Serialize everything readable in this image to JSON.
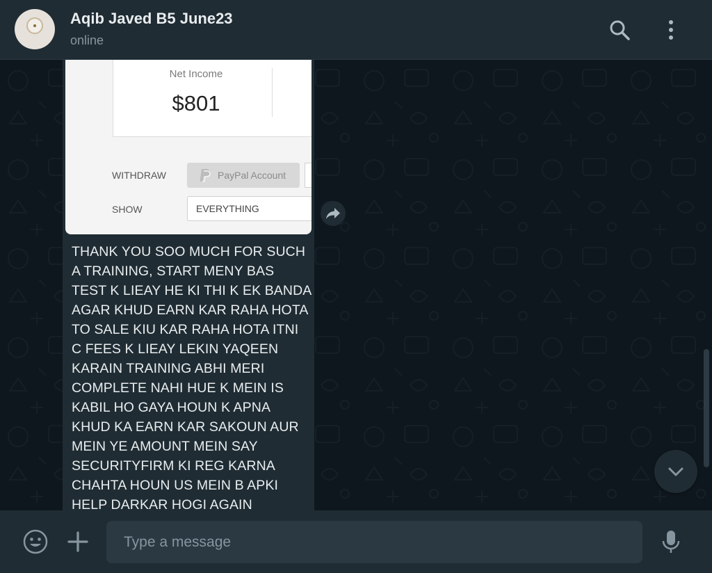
{
  "header": {
    "contact_name": "Aqib Javed B5 June23",
    "status": "online",
    "icons": [
      "search-icon",
      "menu-icon"
    ]
  },
  "message": {
    "screenshot": {
      "net_income_label": "Net Income",
      "net_income_value": "$801",
      "withdraw_label": "WITHDRAW",
      "paypal_button": "PayPal Account",
      "show_label": "SHOW",
      "show_value": "EVERYTHING"
    },
    "text": "THANK YOU SOO MUCH FOR SUCH A TRAINING, START MENY BAS TEST K LIEAY HE KI THI K EK BANDA AGAR KHUD EARN KAR RAHA HOTA TO SALE KIU KAR RAHA HOTA ITNI C FEES K LIEAY LEKIN YAQEEN KARAIN TRAINING ABHI MERI COMPLETE NAHI HUE K MEIN IS KABIL HO GAYA HOUN K APNA KHUD KA EARN KAR SAKOUN AUR MEIN YE AMOUNT MEIN SAY SECURITYFIRM KI REG KARNA CHAHTA HOUN US MEIN B APKI HELP DARKAR HOGI AGAIN"
  },
  "composer": {
    "placeholder": "Type a message",
    "icons": [
      "emoji-icon",
      "plus-icon",
      "mic-icon"
    ]
  },
  "colors": {
    "header_bg": "#202c33",
    "chat_bg": "#0e171d",
    "bubble_bg": "#1f2c33",
    "text_primary": "#e9edef",
    "text_secondary": "#8696a0"
  }
}
